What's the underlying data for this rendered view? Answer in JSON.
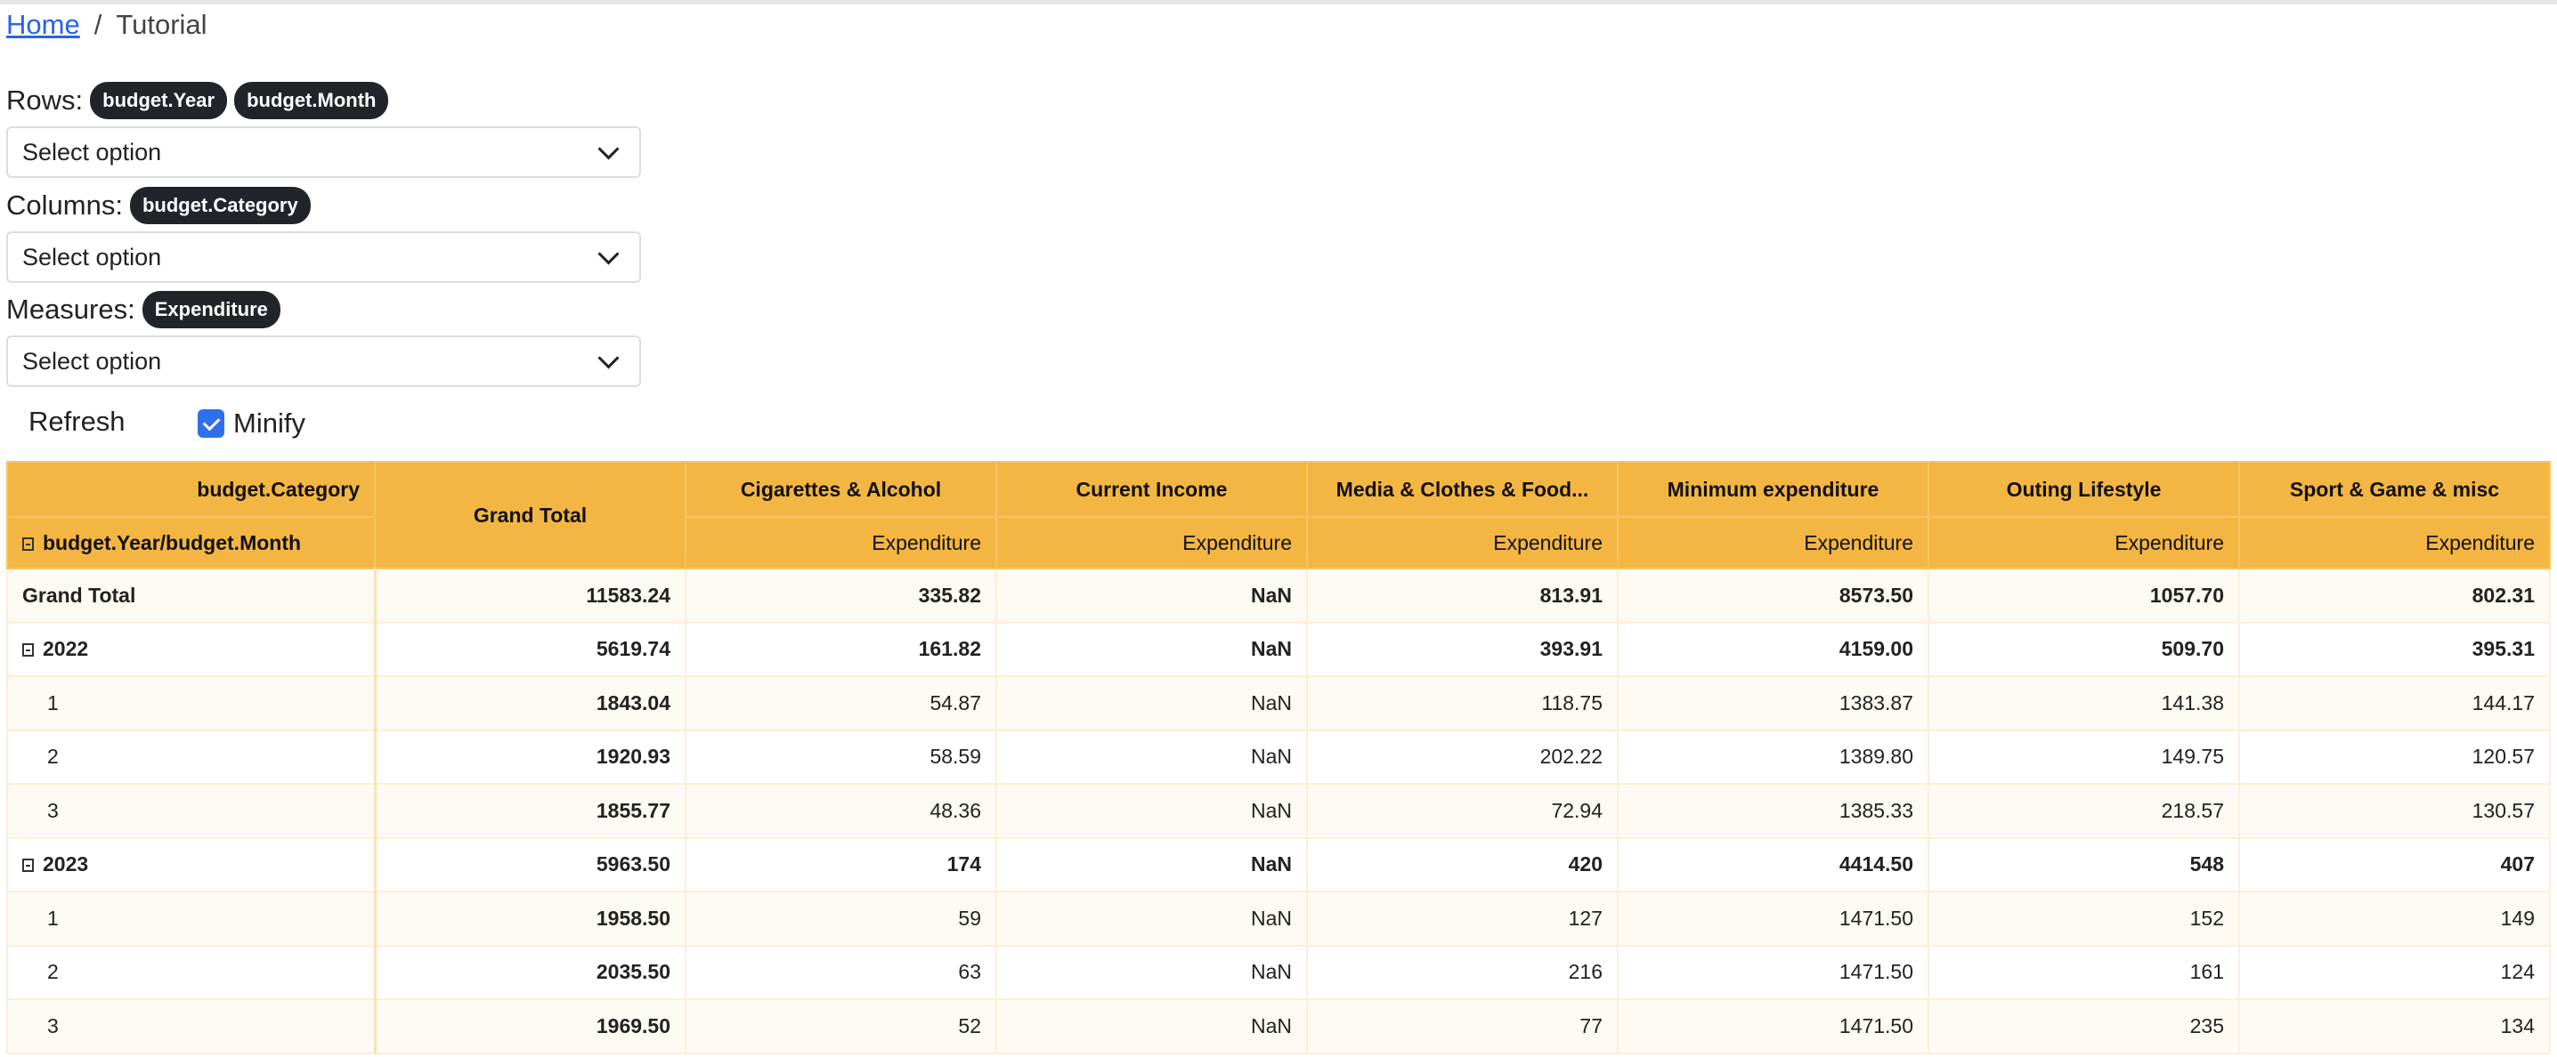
{
  "breadcrumb": {
    "home": "Home",
    "separator": "/",
    "current": "Tutorial"
  },
  "rows": {
    "label": "Rows:",
    "chips": [
      "budget.Year",
      "budget.Month"
    ],
    "select_placeholder": "Select option"
  },
  "columns": {
    "label": "Columns:",
    "chips": [
      "budget.Category"
    ],
    "select_placeholder": "Select option"
  },
  "measures": {
    "label": "Measures:",
    "chips": [
      "Expenditure"
    ],
    "select_placeholder": "Select option"
  },
  "controls": {
    "refresh": "Refresh",
    "minify": "Minify",
    "minify_checked": true
  },
  "table": {
    "corner_top": "budget.Category",
    "corner_bottom": "budget.Year/budget.Month",
    "grand_total_header": "Grand Total",
    "categories": [
      "Cigarettes & Alcohol",
      "Current Income",
      "Media & Clothes & Food...",
      "Minimum expenditure",
      "Outing Lifestyle",
      "Sport & Game & misc"
    ],
    "measure": "Expenditure",
    "rows": [
      {
        "label": "Grand Total",
        "type": "total",
        "total": "11583.24",
        "values": [
          "335.82",
          "NaN",
          "813.91",
          "8573.50",
          "1057.70",
          "802.31"
        ]
      },
      {
        "label": "2022",
        "type": "year",
        "total": "5619.74",
        "values": [
          "161.82",
          "NaN",
          "393.91",
          "4159.00",
          "509.70",
          "395.31"
        ]
      },
      {
        "label": "1",
        "type": "month",
        "total": "1843.04",
        "values": [
          "54.87",
          "NaN",
          "118.75",
          "1383.87",
          "141.38",
          "144.17"
        ]
      },
      {
        "label": "2",
        "type": "month",
        "total": "1920.93",
        "values": [
          "58.59",
          "NaN",
          "202.22",
          "1389.80",
          "149.75",
          "120.57"
        ]
      },
      {
        "label": "3",
        "type": "month",
        "total": "1855.77",
        "values": [
          "48.36",
          "NaN",
          "72.94",
          "1385.33",
          "218.57",
          "130.57"
        ]
      },
      {
        "label": "2023",
        "type": "year",
        "total": "5963.50",
        "values": [
          "174",
          "NaN",
          "420",
          "4414.50",
          "548",
          "407"
        ]
      },
      {
        "label": "1",
        "type": "month",
        "total": "1958.50",
        "values": [
          "59",
          "NaN",
          "127",
          "1471.50",
          "152",
          "149"
        ]
      },
      {
        "label": "2",
        "type": "month",
        "total": "2035.50",
        "values": [
          "63",
          "NaN",
          "216",
          "1471.50",
          "161",
          "124"
        ]
      },
      {
        "label": "3",
        "type": "month",
        "total": "1969.50",
        "values": [
          "52",
          "NaN",
          "77",
          "1471.50",
          "235",
          "134"
        ]
      }
    ]
  }
}
